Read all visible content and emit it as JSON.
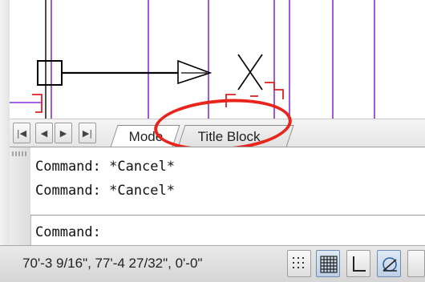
{
  "tabs": {
    "model_label": "Mode",
    "title_block_label": "Title Block"
  },
  "tab_nav": {
    "first_icon": "first-layout-icon",
    "prev_icon": "previous-layout-icon",
    "next_icon": "next-layout-icon",
    "last_icon": "last-layout-icon"
  },
  "command_window": {
    "history": [
      "Command: *Cancel*",
      "Command: *Cancel*"
    ],
    "prompt": "Command:"
  },
  "status_bar": {
    "coordinates": "70'-3 9/16\", 77'-4 27/32\", 0'-0\"",
    "buttons": [
      "snap-grid-icon",
      "grid-display-icon",
      "ortho-mode-icon",
      "polar-tracking-icon"
    ]
  },
  "drawing": {
    "colors": {
      "guide_line": "#8a2be2",
      "bracket": "#e02020",
      "geometry": "#000000"
    }
  },
  "annotation": {
    "color": "#e8241c"
  }
}
